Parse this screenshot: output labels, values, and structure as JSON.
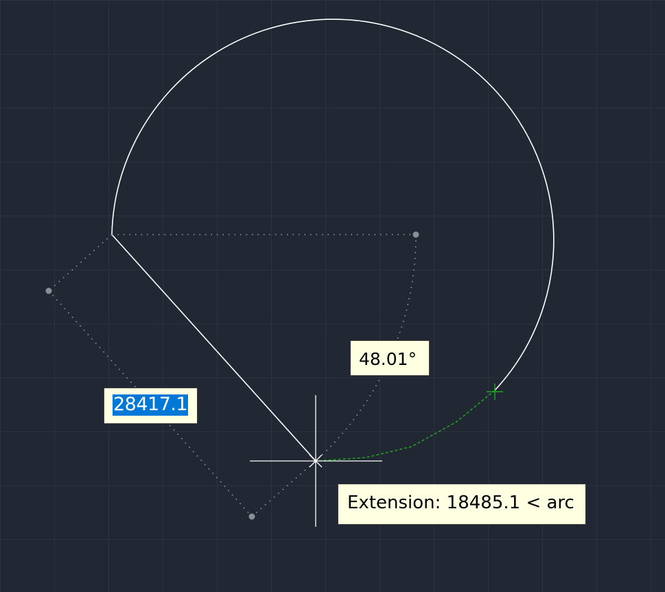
{
  "canvas": {
    "background": "#212833",
    "grid_color": "#2c3441",
    "geometry_color": "#ffffff",
    "guide_color": "#9aa0a6",
    "preview_color": "#1fa81f",
    "crosshair_color": "#ffffff"
  },
  "dynamic_input": {
    "angle_value": "48.01°",
    "length_value": "28417.1",
    "length_selected": true,
    "selection_color": "#0078d7"
  },
  "tooltip": {
    "text": "Extension: 18485.1 < arc"
  }
}
